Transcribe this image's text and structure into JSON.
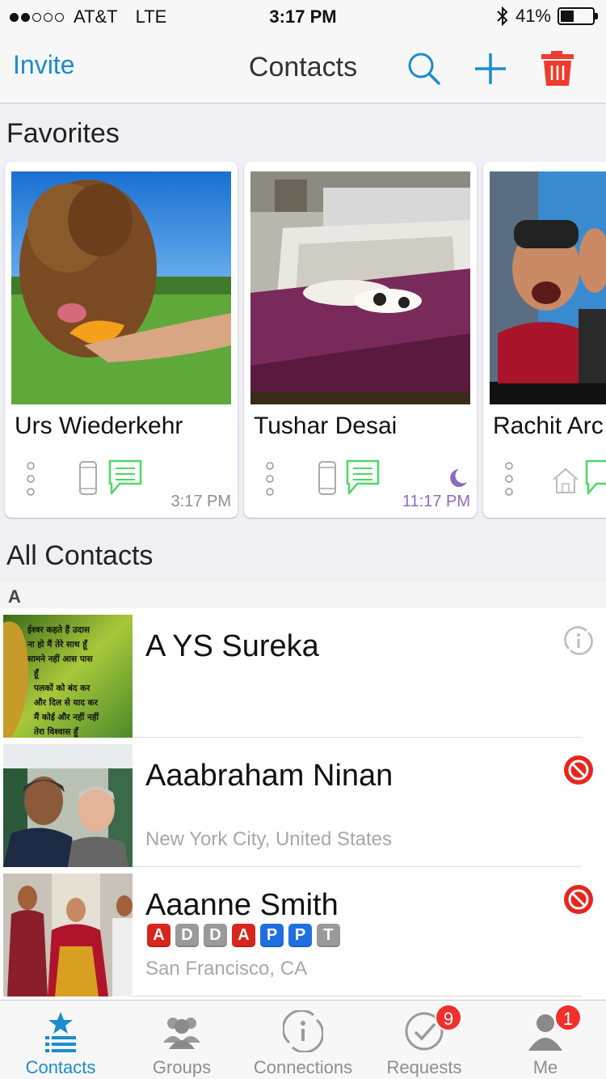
{
  "status_bar": {
    "carrier": "AT&T",
    "network": "LTE",
    "signal_bars_filled": 2,
    "signal_bars_total": 5,
    "time": "3:17 PM",
    "battery_percent": "41%",
    "battery_level": 0.41
  },
  "navbar": {
    "invite_label": "Invite",
    "title": "Contacts",
    "icons": [
      "search-icon",
      "add-icon",
      "trash-icon"
    ]
  },
  "favorites": {
    "heading": "Favorites",
    "cards": [
      {
        "name": "Urs Wiederkehr",
        "time": "3:17 PM",
        "device": "mobile",
        "status": ""
      },
      {
        "name": "Tushar Desai",
        "time": "11:17 PM",
        "device": "mobile",
        "status": "moon"
      },
      {
        "name": "Rachit Arc",
        "time": "",
        "device": "home",
        "status": ""
      }
    ]
  },
  "all_contacts": {
    "heading": "All Contacts",
    "section_letter": "A",
    "rows": [
      {
        "name": "A YS Sureka",
        "location": "",
        "action": "connection-icon",
        "avatar_text": [
          "ईश्वर कहते हैं उदास",
          "ना हो मैं तेरे साथ हूँ",
          "सामने नहीं आस पास",
          "हूँ",
          "पलकों को बंद कर",
          "और दिल से याद कर",
          "मैं कोई और नहीं नहीं",
          "तेरा विश्वास हूँ"
        ]
      },
      {
        "name": "Aaabraham Ninan",
        "location": "New York City, United States",
        "action": "blocked-icon"
      },
      {
        "name": "Aaanne Smith",
        "location": "San Francisco, CA",
        "action": "blocked-icon",
        "tags": [
          {
            "letter": "A",
            "color": "#d9261c"
          },
          {
            "letter": "D",
            "color": "#9a9a9a"
          },
          {
            "letter": "D",
            "color": "#9a9a9a"
          },
          {
            "letter": "A",
            "color": "#d9261c"
          },
          {
            "letter": "P",
            "color": "#1f6fe0"
          },
          {
            "letter": "P",
            "color": "#1f6fe0"
          },
          {
            "letter": "T",
            "color": "#9a9a9a"
          }
        ]
      }
    ]
  },
  "tabbar": {
    "tabs": [
      {
        "label": "Contacts",
        "active": true,
        "badge": ""
      },
      {
        "label": "Groups",
        "active": false,
        "badge": ""
      },
      {
        "label": "Connections",
        "active": false,
        "badge": ""
      },
      {
        "label": "Requests",
        "active": false,
        "badge": "9"
      },
      {
        "label": "Me",
        "active": false,
        "badge": "1"
      }
    ]
  },
  "colors": {
    "accent": "#1b8ccd",
    "chat_green": "#4cd964",
    "trash_red": "#ef3b2d",
    "blocked_red": "#e8251d",
    "away_purple": "#8e6bbf"
  }
}
